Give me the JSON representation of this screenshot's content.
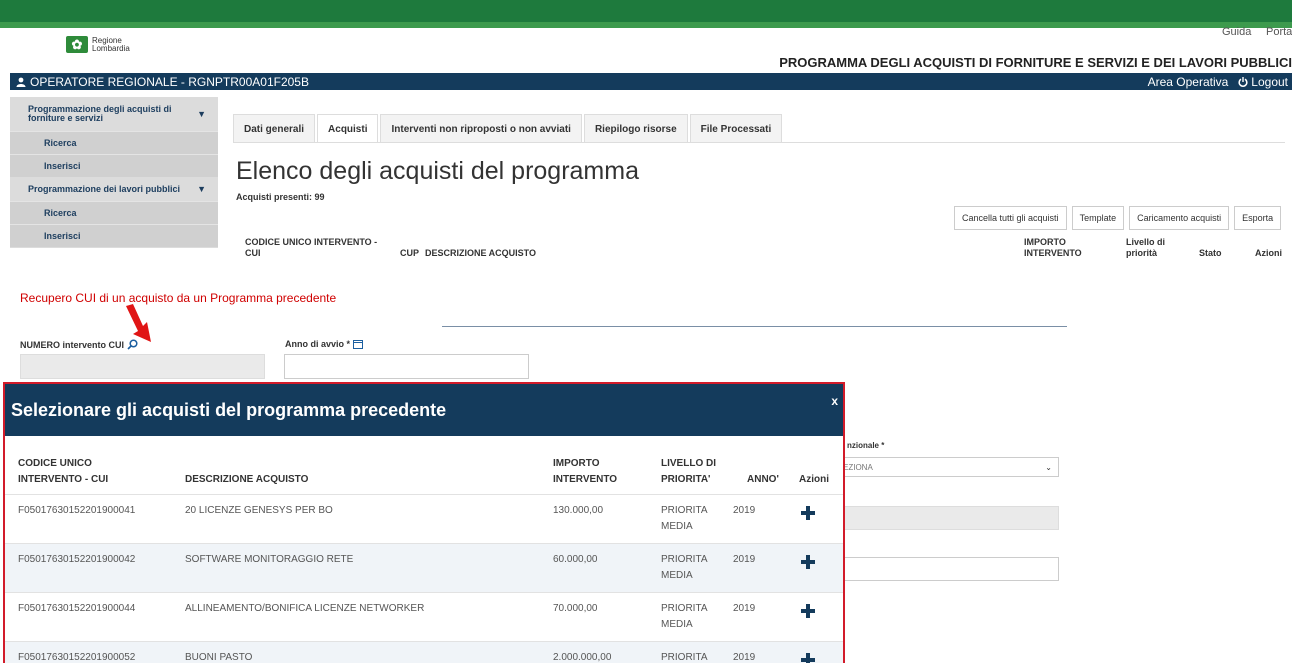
{
  "header": {
    "logo_line1": "Regione",
    "logo_line2": "Lombardia",
    "link_guida": "Guida",
    "link_portale": "Portale",
    "program_title": "PROGRAMMA DEGLI ACQUISTI DI FORNITURE E SERVIZI E DEI LAVORI PUBBLICI"
  },
  "operator_bar": {
    "user": "OPERATORE REGIONALE - RGNPTR00A01F205B",
    "area": "Area Operativa",
    "logout": "Logout"
  },
  "sidebar": {
    "sections": [
      {
        "title": "Programmazione degli acquisti di forniture e servizi",
        "items": [
          "Ricerca",
          "Inserisci"
        ]
      },
      {
        "title": "Programmazione dei lavori pubblici",
        "items": [
          "Ricerca",
          "Inserisci"
        ]
      }
    ]
  },
  "tabs": [
    "Dati generali",
    "Acquisti",
    "Interventi non riproposti o non avviati",
    "Riepilogo risorse",
    "File Processati"
  ],
  "main": {
    "title": "Elenco degli acquisti del programma",
    "count_text": "Acquisti presenti: 99",
    "buttons": [
      "Cancella tutti gli acquisti",
      "Template",
      "Caricamento acquisti",
      "Esporta"
    ],
    "columns": {
      "cui": "CODICE UNICO INTERVENTO - CUI",
      "cup": "CUP",
      "descr": "DESCRIZIONE ACQUISTO",
      "importo": "IMPORTO INTERVENTO",
      "livello": "Livello di priorità",
      "stato": "Stato",
      "azioni": "Azioni"
    }
  },
  "annotation": "Recupero CUI di un acquisto da un Programma precedente",
  "form": {
    "cui_label": "NUMERO intervento CUI",
    "anno_label": "Anno di avvio *",
    "right_label": "nzionale *",
    "right_select": "EZIONA"
  },
  "modal": {
    "title": "Selezionare gli acquisti del programma precedente",
    "close": "x",
    "columns": {
      "cui": "CODICE UNICO INTERVENTO - CUI",
      "descr": "DESCRIZIONE ACQUISTO",
      "importo": "IMPORTO INTERVENTO",
      "livello": "LIVELLO DI PRIORITA'",
      "anno": "ANNO'",
      "azioni": "Azioni"
    },
    "rows": [
      {
        "cui": "F05017630152201900041",
        "descr": "20 LICENZE GENESYS PER BO",
        "importo": "130.000,00",
        "livello": "PRIORITA MEDIA",
        "anno": "2019"
      },
      {
        "cui": "F05017630152201900042",
        "descr": "SOFTWARE MONITORAGGIO RETE",
        "importo": "60.000,00",
        "livello": "PRIORITA MEDIA",
        "anno": "2019"
      },
      {
        "cui": "F05017630152201900044",
        "descr": "ALLINEAMENTO/BONIFICA LICENZE NETWORKER",
        "importo": "70.000,00",
        "livello": "PRIORITA MEDIA",
        "anno": "2019"
      },
      {
        "cui": "F05017630152201900052",
        "descr": "BUONI PASTO",
        "importo": "2.000.000,00",
        "livello": "PRIORITA",
        "anno": "2019"
      }
    ]
  },
  "colors": {
    "green": "#1e7a3d",
    "navy": "#143b5c",
    "red": "#d21b2a"
  }
}
